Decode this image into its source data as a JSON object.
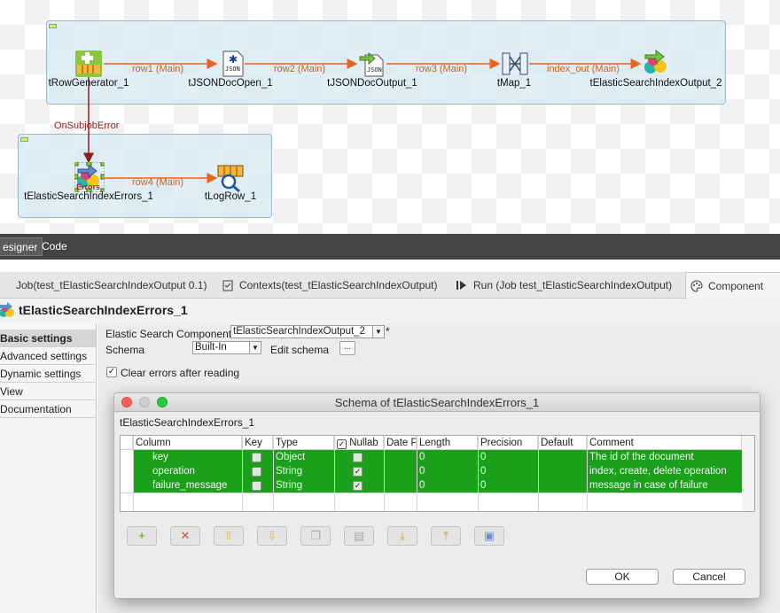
{
  "canvas": {
    "components": [
      {
        "label": "tRowGenerator_1"
      },
      {
        "label": "tJSONDocOpen_1"
      },
      {
        "label": "tJSONDocOutput_1"
      },
      {
        "label": "tMap_1"
      },
      {
        "label": "tElasticSearchIndexOutput_2"
      },
      {
        "label": "tElasticSearchIndexErrors_1"
      },
      {
        "label": "tLogRow_1"
      }
    ],
    "flows": [
      "row1 (Main)",
      "row2 (Main)",
      "row3 (Main)",
      "index_out (Main)",
      "row4 (Main)"
    ],
    "trigger": "OnSubjobError",
    "error_badge": "Errors",
    "flow_color": "#e8641e"
  },
  "view_tabs": {
    "designer": "esigner",
    "code": "Code"
  },
  "editor_tabs": [
    {
      "label": "Job(test_tElasticSearchIndexOutput 0.1)"
    },
    {
      "label": "Contexts(test_tElasticSearchIndexOutput)"
    },
    {
      "label": "Run (Job test_tElasticSearchIndexOutput)"
    },
    {
      "label": "Component"
    }
  ],
  "component_title": "tElasticSearchIndexErrors_1",
  "left_nav": [
    "Basic settings",
    "Advanced settings",
    "Dynamic settings",
    "View",
    "Documentation"
  ],
  "settings": {
    "es_component_label": "Elastic Search Component",
    "es_component_value": "tElasticSearchIndexOutput_2",
    "modified_marker": "*",
    "schema_label": "Schema",
    "schema_value": "Built-In",
    "edit_schema_label": "Edit schema",
    "edit_schema_button": "...",
    "clear_errors_label": "Clear errors after reading",
    "clear_errors_checked": true
  },
  "dialog": {
    "title": "Schema of tElasticSearchIndexErrors_1",
    "subtitle": "tElasticSearchIndexErrors_1",
    "columns": [
      "Column",
      "Key",
      "Type",
      "Nullab",
      "Date P",
      "Length",
      "Precision",
      "Default",
      "Comment"
    ],
    "rows": [
      {
        "column": "key",
        "key": false,
        "type": "Object",
        "nullable": false,
        "date": "",
        "length": "0",
        "precision": "0",
        "default": "",
        "comment": "The id of the document"
      },
      {
        "column": "operation",
        "key": false,
        "type": "String",
        "nullable": true,
        "date": "",
        "length": "0",
        "precision": "0",
        "default": "",
        "comment": "index, create, delete operation"
      },
      {
        "column": "failure_message",
        "key": false,
        "type": "String",
        "nullable": true,
        "date": "",
        "length": "0",
        "precision": "0",
        "default": "",
        "comment": "message in case of failure"
      }
    ],
    "row_color": "#1aa01a",
    "toolbar_icons": [
      "add-icon",
      "remove-icon",
      "move-up-icon",
      "move-down-icon",
      "copy-icon",
      "paste-icon",
      "import-icon",
      "export-icon",
      "save-icon"
    ],
    "ok_label": "OK",
    "cancel_label": "Cancel"
  }
}
